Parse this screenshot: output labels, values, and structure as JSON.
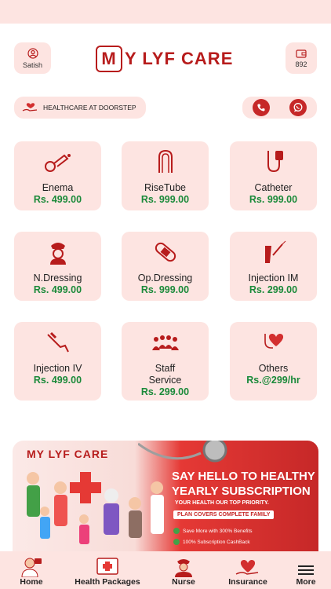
{
  "header": {
    "user_name": "Satish",
    "wallet_balance": "892",
    "logo_text": "Y LYF CARE",
    "logo_letter": "M"
  },
  "doorstep_pill": {
    "label": "HEALTHCARE AT DOORSTEP"
  },
  "services": [
    {
      "title": "Enema",
      "price": "Rs. 499.00",
      "icon": "enema-icon"
    },
    {
      "title": "RiseTube",
      "price": "Rs. 999.00",
      "icon": "tube-icon"
    },
    {
      "title": "Catheter",
      "price": "Rs. 999.00",
      "icon": "catheter-icon"
    },
    {
      "title": "N.Dressing",
      "price": "Rs. 499.00",
      "icon": "nurse-dressing-icon"
    },
    {
      "title": "Op.Dressing",
      "price": "Rs. 999.00",
      "icon": "bandage-icon"
    },
    {
      "title": "Injection IM",
      "price": "Rs. 299.00",
      "icon": "injection-icon"
    },
    {
      "title": "Injection IV",
      "price": "Rs. 499.00",
      "icon": "iv-icon"
    },
    {
      "title": "Staff Service",
      "price": "Rs. 299.00",
      "icon": "staff-icon"
    },
    {
      "title": "Others",
      "price": "Rs.@299/hr",
      "icon": "heart-stethoscope-icon"
    }
  ],
  "banner": {
    "logo": "MY LYF CARE",
    "headline_1": "SAY HELLO TO HEALTHY",
    "headline_2": "YEARLY SUBSCRIPTION",
    "tagline": "YOUR HEALTH OUR TOP PRIORITY.",
    "plan": "PLAN COVERS COMPLETE FAMILY",
    "benefit_1": "Save More with 300% Benefits",
    "benefit_2": "100% Subscription CashBack"
  },
  "bottom_nav": [
    {
      "label": "Home",
      "icon": "doctor-icon"
    },
    {
      "label": "Health Packages",
      "icon": "packages-icon"
    },
    {
      "label": "Nurse",
      "icon": "nurse-icon"
    },
    {
      "label": "Insurance",
      "icon": "insurance-icon"
    },
    {
      "label": "More",
      "icon": "menu-icon"
    }
  ],
  "colors": {
    "accent": "#c62828",
    "card_bg": "#fde4e1",
    "price": "#1b8a3a"
  }
}
